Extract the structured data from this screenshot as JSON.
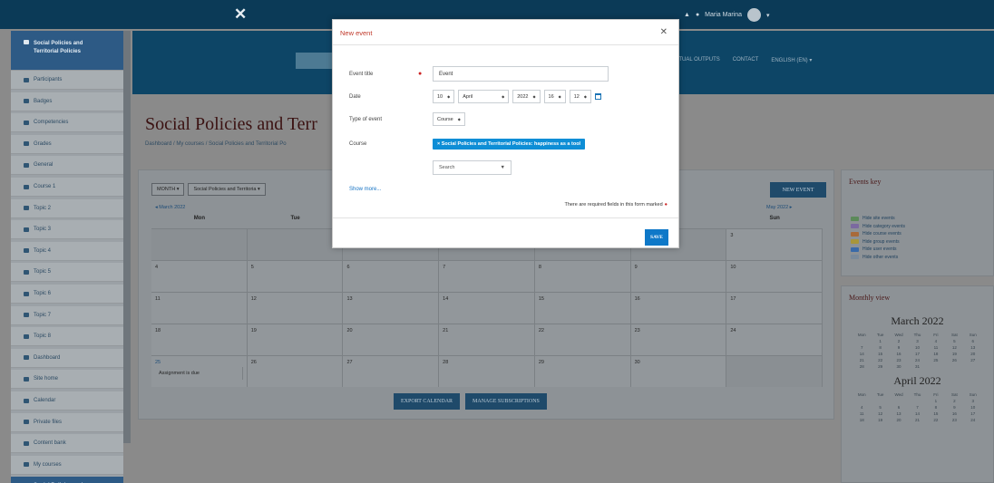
{
  "topbar": {
    "close_icon": "close-icon",
    "user_name": "Maria Marina"
  },
  "sidebar": {
    "items": [
      {
        "label": "Social Policies and Territorial Policies",
        "icon": "hat-icon",
        "active": true
      },
      {
        "label": "Participants",
        "icon": "users-icon"
      },
      {
        "label": "Badges",
        "icon": "badge-icon"
      },
      {
        "label": "Competencies",
        "icon": "check-icon"
      },
      {
        "label": "Grades",
        "icon": "table-icon"
      },
      {
        "label": "General",
        "icon": "folder-icon"
      },
      {
        "label": "Course 1",
        "icon": "folder-icon"
      },
      {
        "label": "Topic 2",
        "icon": "folder-icon"
      },
      {
        "label": "Topic 3",
        "icon": "folder-icon"
      },
      {
        "label": "Topic 4",
        "icon": "folder-icon"
      },
      {
        "label": "Topic 5",
        "icon": "folder-icon"
      },
      {
        "label": "Topic 6",
        "icon": "folder-icon"
      },
      {
        "label": "Topic 7",
        "icon": "folder-icon"
      },
      {
        "label": "Topic 8",
        "icon": "folder-icon"
      },
      {
        "label": "Dashboard",
        "icon": "dashboard-icon"
      },
      {
        "label": "Site home",
        "icon": "home-icon"
      },
      {
        "label": "Calendar",
        "icon": "calendar-icon"
      },
      {
        "label": "Private files",
        "icon": "file-icon"
      },
      {
        "label": "Content bank",
        "icon": "pencil-icon"
      },
      {
        "label": "My courses",
        "icon": "hat-icon"
      },
      {
        "label": "Social Policies and",
        "icon": "hat-icon",
        "active": true
      }
    ]
  },
  "header": {
    "nav_links": [
      "CTUAL OUTPUTS",
      "CONTACT",
      "ENGLISH (EN) ▾"
    ]
  },
  "page": {
    "title": "Social Policies and Terr",
    "breadcrumb": "Dashboard / My courses / Social Policies and Territorial Po"
  },
  "calendar": {
    "view_select": "MONTH ▾",
    "course_select": "Social Policies and Territoria ▾",
    "new_event": "NEW EVENT",
    "prev": "◂ March 2022",
    "next": "May 2022 ▸",
    "weekdays": [
      "Mon",
      "Tue",
      "",
      "",
      "",
      "",
      "Sun"
    ],
    "weeks": [
      [
        "",
        "",
        "",
        "",
        "",
        "",
        "3"
      ],
      [
        "4",
        "5",
        "6",
        "7",
        "8",
        "9",
        "10"
      ],
      [
        "11",
        "12",
        "13",
        "14",
        "15",
        "16",
        "17"
      ],
      [
        "18",
        "19",
        "20",
        "21",
        "22",
        "23",
        "24"
      ],
      [
        "25",
        "26",
        "27",
        "28",
        "29",
        "30",
        ""
      ]
    ],
    "event_label": "Assignment is due",
    "export": "EXPORT CALENDAR",
    "manage": "MANAGE SUBSCRIPTIONS"
  },
  "events_key": {
    "title": "Events key",
    "items": [
      {
        "label": "Hide site events",
        "color": "#5c8a5a"
      },
      {
        "label": "Hide category events",
        "color": "#7b6aa0"
      },
      {
        "label": "Hide course events",
        "color": "#a86a3a"
      },
      {
        "label": "Hide group events",
        "color": "#a8963a"
      },
      {
        "label": "Hide user events",
        "color": "#3a6aa8"
      },
      {
        "label": "Hide other events",
        "color": "#7a8a9a"
      }
    ]
  },
  "monthly": {
    "title": "Monthly view",
    "month1": "March 2022",
    "month2": "April 2022",
    "days_head": [
      "Mon",
      "Tue",
      "Wed",
      "Thu",
      "Fri",
      "Sat",
      "Sun"
    ],
    "march": [
      "",
      "1",
      "2",
      "3",
      "4",
      "5",
      "6",
      "7",
      "8",
      "9",
      "10",
      "11",
      "12",
      "13",
      "14",
      "15",
      "16",
      "17",
      "18",
      "19",
      "20",
      "21",
      "22",
      "23",
      "24",
      "25",
      "26",
      "27",
      "28",
      "29",
      "30",
      "31",
      "",
      "",
      ""
    ],
    "april": [
      "",
      "",
      "",
      "",
      "1",
      "2",
      "3",
      "4",
      "5",
      "6",
      "7",
      "8",
      "9",
      "10",
      "11",
      "12",
      "13",
      "14",
      "15",
      "16",
      "17",
      "18",
      "19",
      "20",
      "21",
      "22",
      "23",
      "24"
    ]
  },
  "modal": {
    "title": "New event",
    "event_title_label": "Event title",
    "event_title_value": "Event",
    "date_label": "Date",
    "date": {
      "day": "10",
      "month": "April",
      "year": "2022",
      "hour": "16",
      "minute": "12"
    },
    "type_label": "Type of event",
    "type_value": "Course",
    "course_label": "Course",
    "course_value": "× Social Policies and Territorial Policies: happiness as a tool",
    "search_placeholder": "Search",
    "show_more": "Show more...",
    "required_note": "There are required fields in this form marked",
    "save": "SAVE"
  },
  "colors": {
    "accent": "#0e78c8",
    "title_red": "#c0392b",
    "course_tag": "#0e8ed6"
  }
}
